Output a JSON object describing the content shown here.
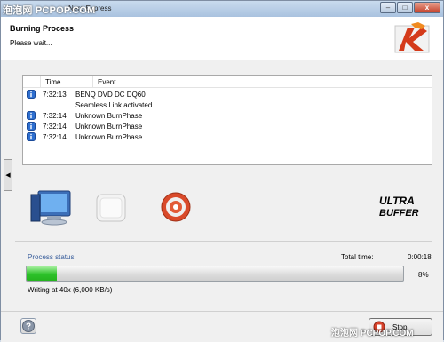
{
  "watermark_top": "泡泡网 PCPOP.COM",
  "window": {
    "title": "Nero Express",
    "minimize": "–",
    "maximize": "□",
    "close": "x"
  },
  "header": {
    "title": "Burning Process",
    "subtitle": "Please wait..."
  },
  "log": {
    "columns": {
      "time": "Time",
      "event": "Event"
    },
    "rows": [
      {
        "time": "7:32:13",
        "event": "BENQ DVD DC DQ60",
        "icon": "info-icon"
      },
      {
        "time": "",
        "event": "Seamless Link activated",
        "icon": ""
      },
      {
        "time": "7:32:14",
        "event": "Unknown BurnPhase",
        "icon": "info-icon"
      },
      {
        "time": "7:32:14",
        "event": "Unknown BurnPhase",
        "icon": "info-icon"
      },
      {
        "time": "7:32:14",
        "event": "Unknown BurnPhase",
        "icon": "info-icon"
      }
    ]
  },
  "side_tab": "◀",
  "icons": [
    "computer-icon",
    "blank-disc-icon",
    "burning-disc-icon",
    "ultra-buffer-logo"
  ],
  "status": {
    "process_label": "Process status:",
    "total_time_label": "Total time:",
    "total_time": "0:00:18",
    "progress_percent": 8,
    "progress_text": "8%",
    "writing": "Writing at 40x (6,000 KB/s)"
  },
  "footer": {
    "help": "?",
    "stop_label": "Stop"
  },
  "watermark_bottom": "泡泡网 PCPOP.COM",
  "colors": {
    "progress": "#2dc22a",
    "status_label": "#3a5f9c",
    "info": "#2e6fd0"
  }
}
